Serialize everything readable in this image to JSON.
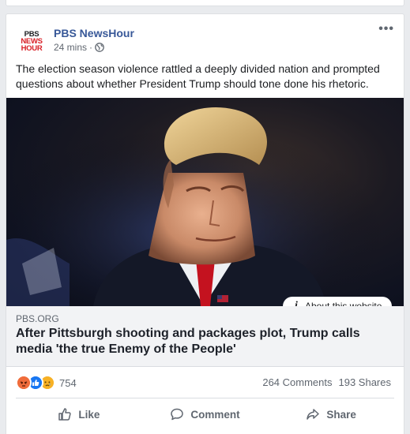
{
  "post": {
    "page_name": "PBS NewsHour",
    "avatar_lines": [
      "PBS",
      "NEWS",
      "HOUR"
    ],
    "time": "24 mins",
    "separator": "·",
    "more": "•••",
    "text": "The election season violence rattled a deeply divided nation and prompted questions about whether President Trump should tone done his rhetoric."
  },
  "link": {
    "info_label": "About this website",
    "domain": "PBS.ORG",
    "headline": "After Pittsburgh shooting and packages plot, Trump calls media 'the true Enemy of the People'"
  },
  "stats": {
    "reactions": [
      "angry",
      "like",
      "sad"
    ],
    "reaction_count": "754",
    "comments": "264 Comments",
    "shares": "193 Shares"
  },
  "actions": {
    "like": "Like",
    "comment": "Comment",
    "share": "Share"
  },
  "colors": {
    "link_blue": "#385898",
    "pbs_red": "#d81f26",
    "secondary_text": "#606770",
    "link_box_bg": "#f2f3f5"
  }
}
